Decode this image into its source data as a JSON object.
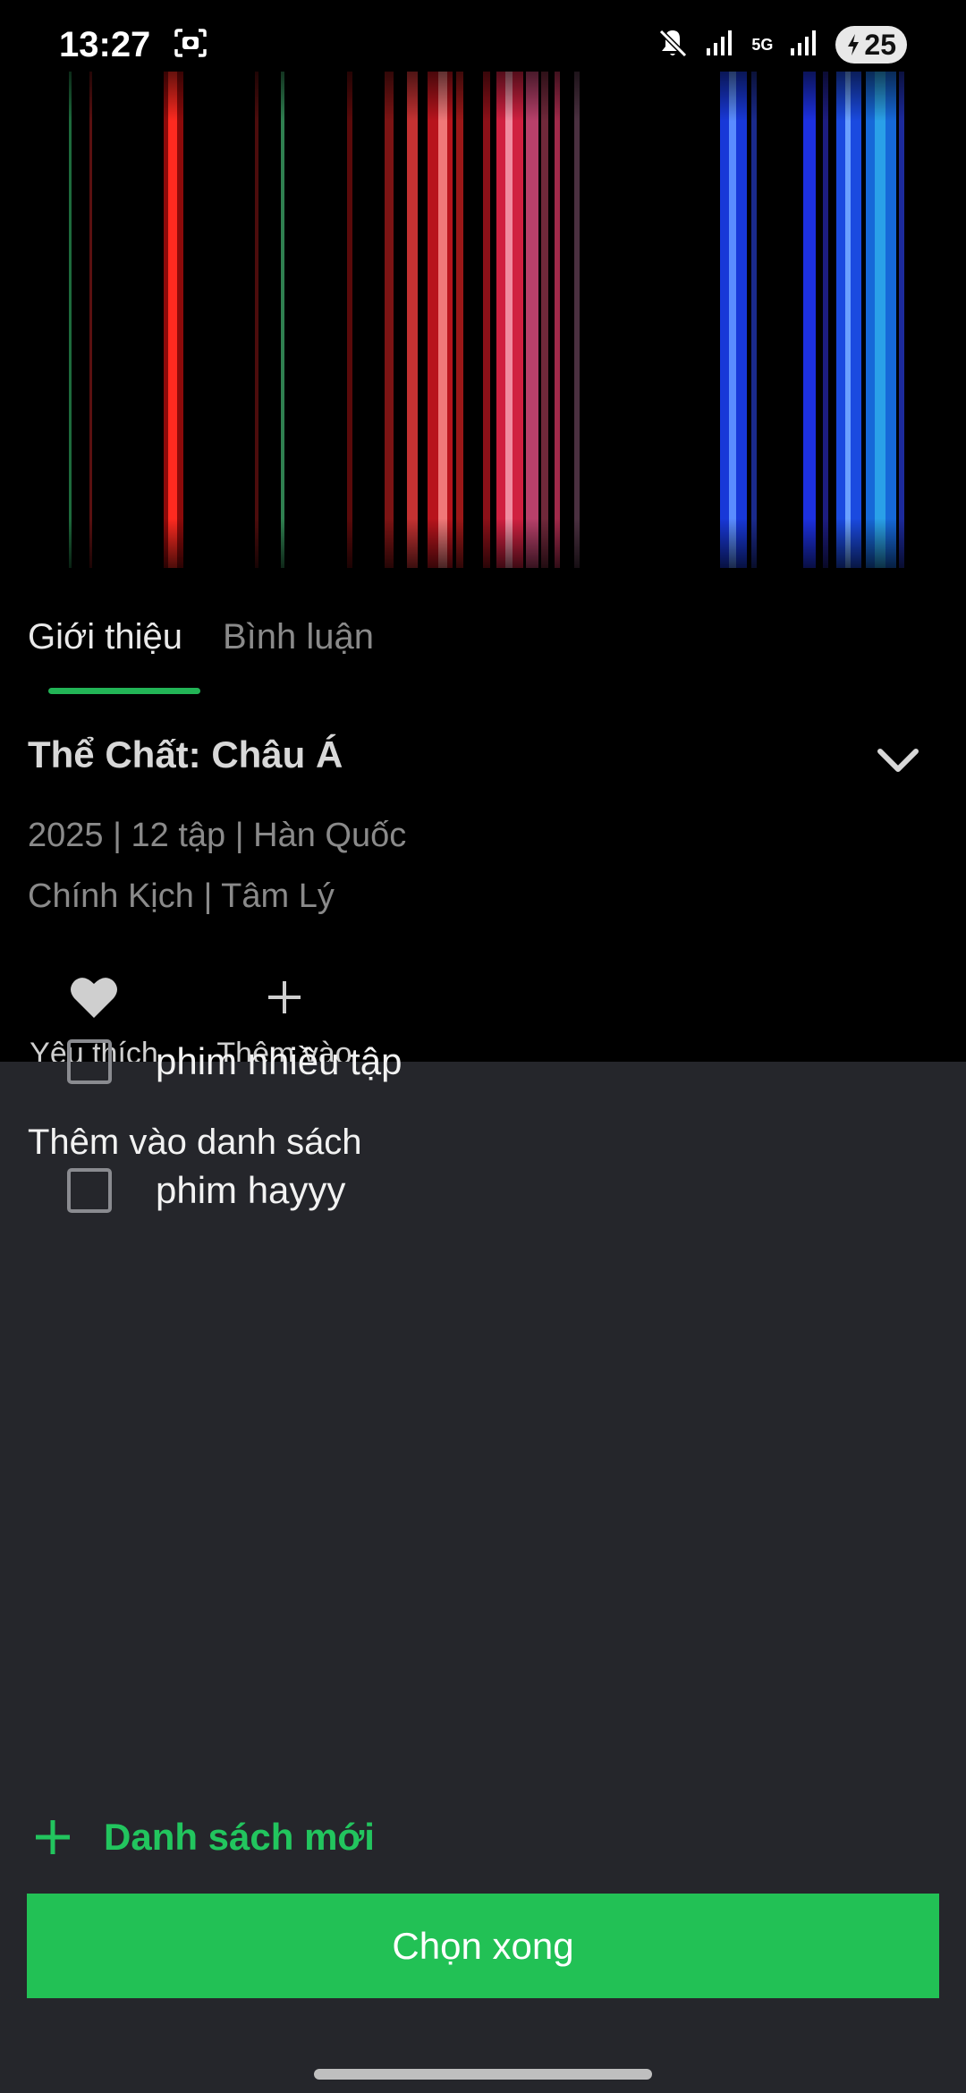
{
  "status_bar": {
    "time": "13:27",
    "network": "5G",
    "battery": "25",
    "icons": [
      "screenshot-icon",
      "mute-icon",
      "signal-icon",
      "battery-charging-icon"
    ]
  },
  "tabs": [
    {
      "label": "Giới thiệu",
      "active": true
    },
    {
      "label": "Bình luận",
      "active": false
    }
  ],
  "show": {
    "title": "Thể Chất: Châu Á",
    "meta_line1": "2025 | 12 tập | Hàn Quốc",
    "meta_line2": "Chính Kịch | Tâm Lý"
  },
  "actions": [
    {
      "label": "Yêu thích",
      "icon": "heart-icon"
    },
    {
      "label": "Thêm vào",
      "icon": "plus-icon"
    }
  ],
  "sheet": {
    "title": "Thêm vào danh sách",
    "items": [
      {
        "label": "phim nhiều tập",
        "checked": false
      },
      {
        "label": "phim hayyy",
        "checked": false
      }
    ],
    "new_list_label": "Danh sách mới",
    "done_label": "Chọn xong"
  },
  "colors": {
    "accent": "#22c155",
    "sheet_bg": "#25262b",
    "background": "#000000"
  }
}
